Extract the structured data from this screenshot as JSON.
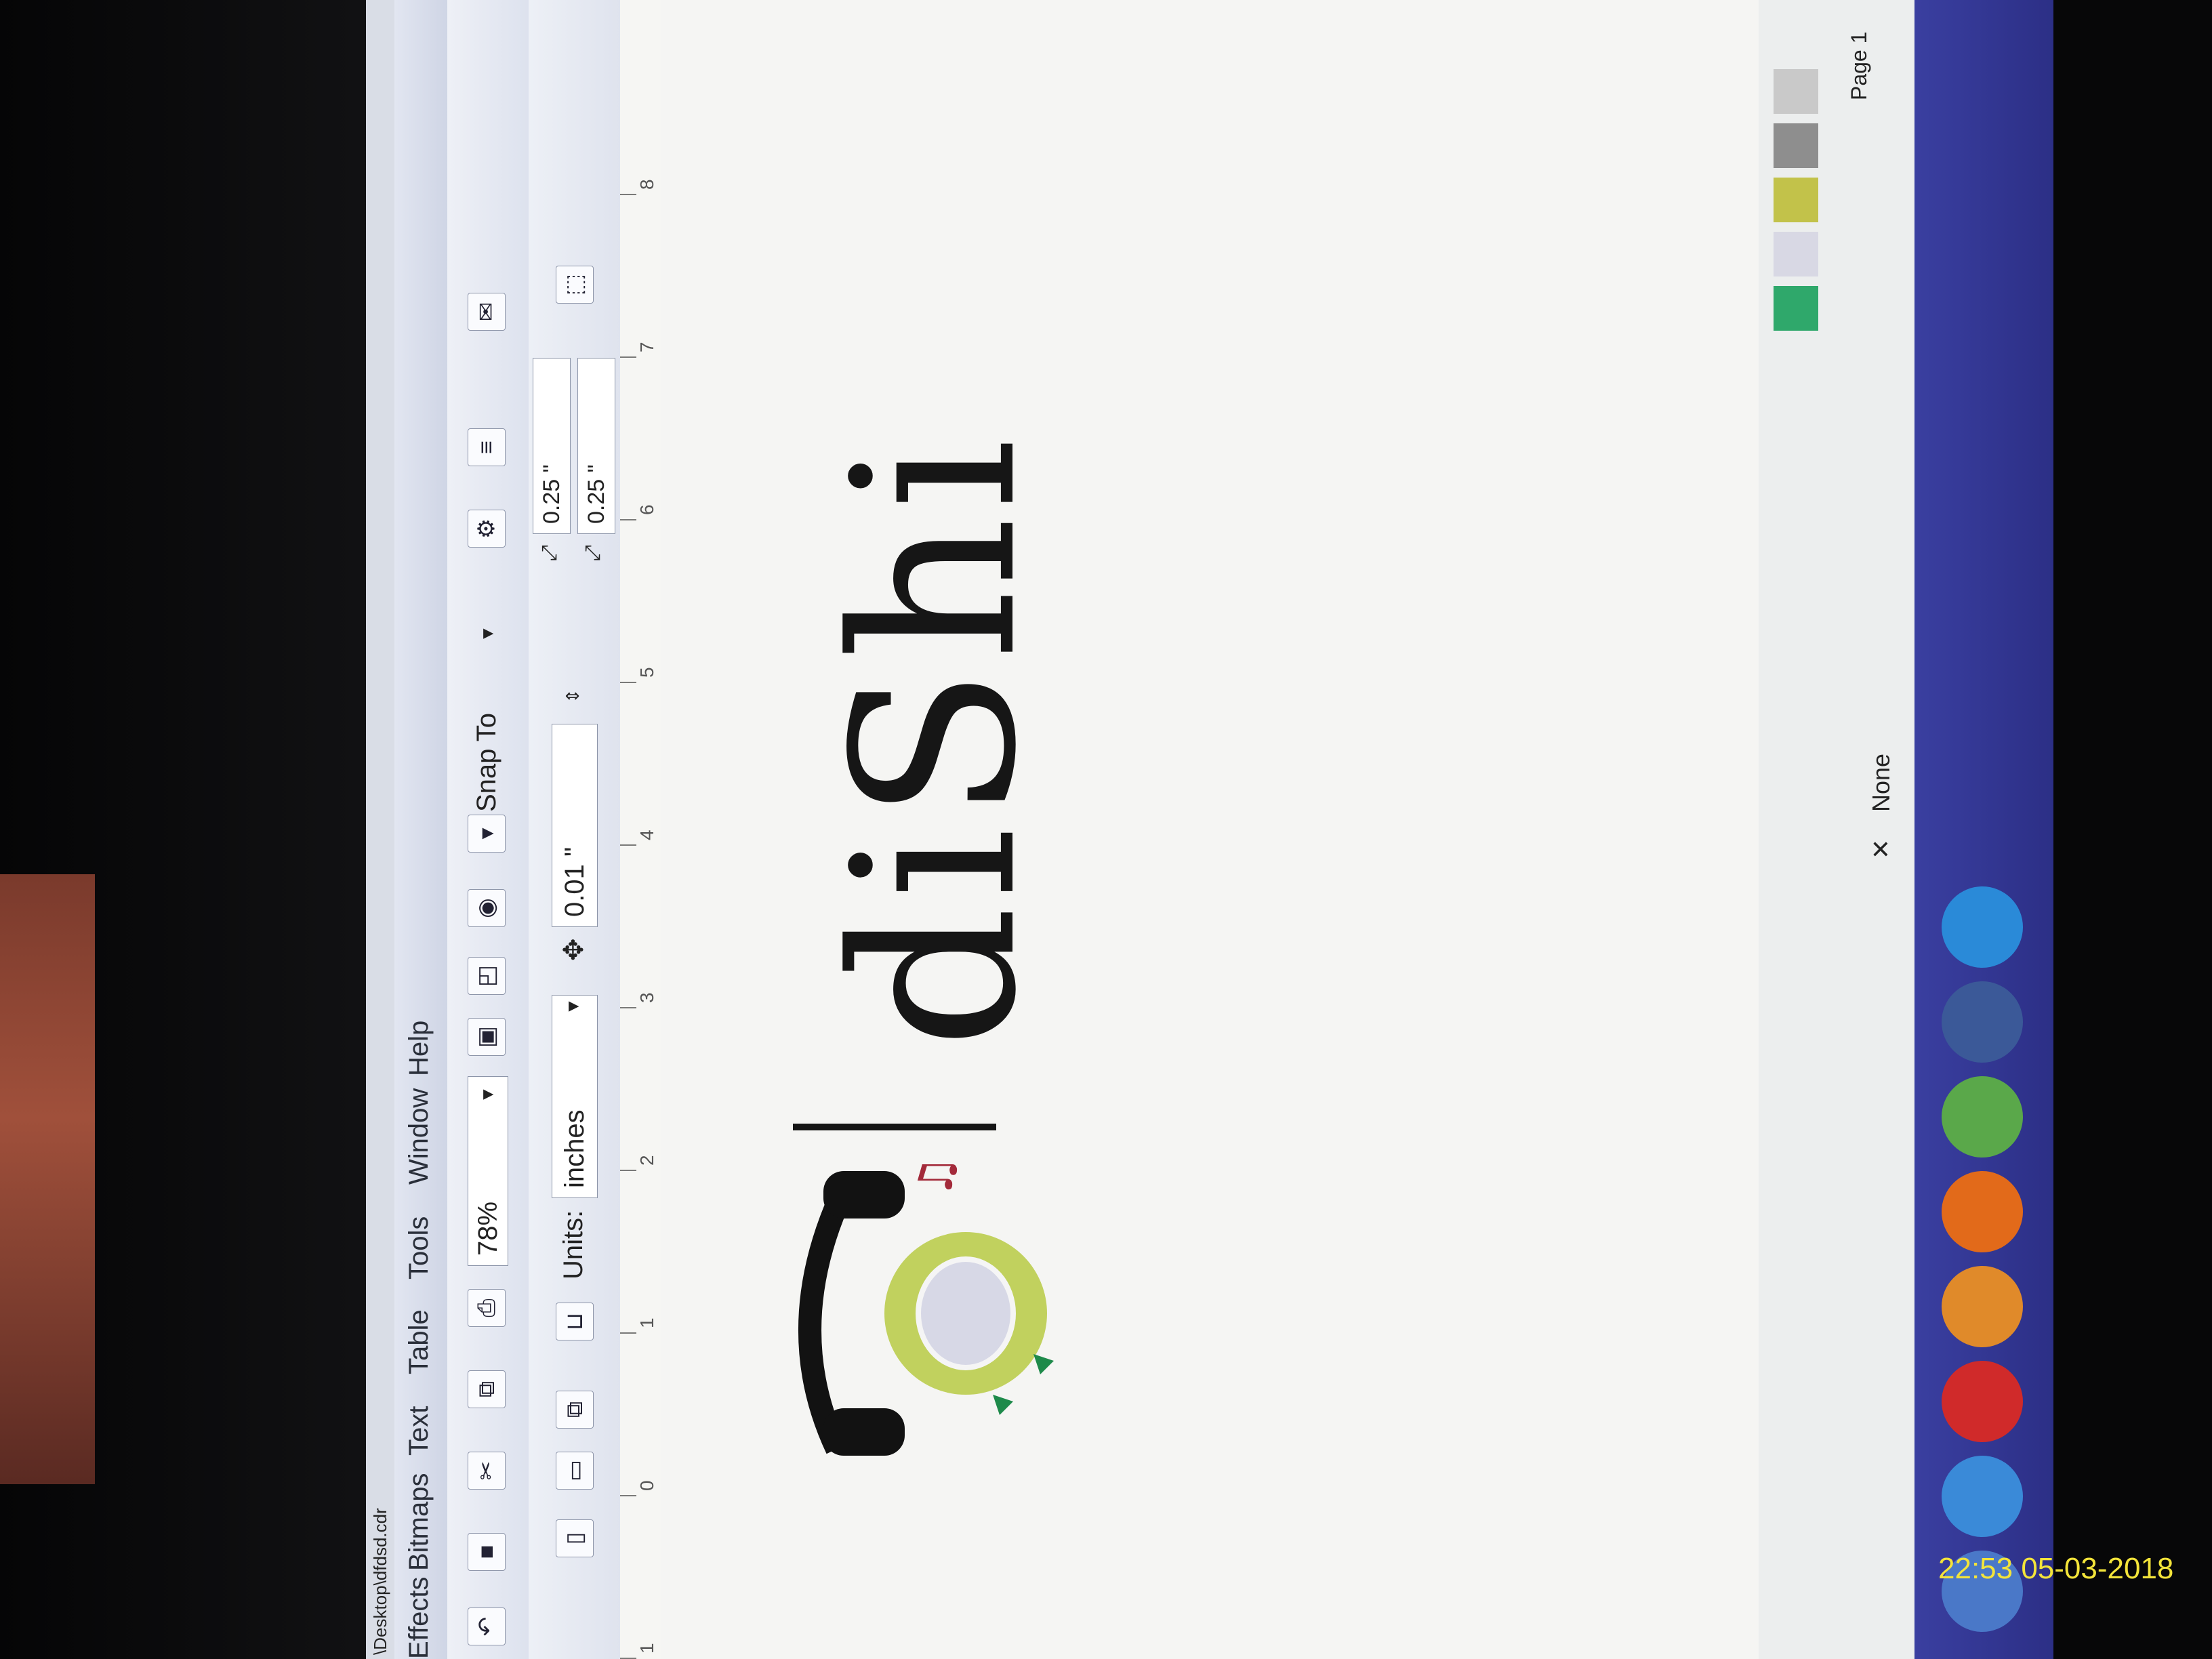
{
  "window": {
    "title": "\\Desktop\\dfdsd.cdr"
  },
  "menu": {
    "items": [
      "Effects",
      "Bitmaps",
      "Text",
      "Table",
      "Tools",
      "Window",
      "Help"
    ]
  },
  "toolbar": {
    "zoom_value": "78%",
    "snap_to_label": "Snap To",
    "units_label": "Units:",
    "units_value": "inches",
    "nudge_value": "0.01 \"",
    "duplicate_x": "0.25 \"",
    "duplicate_y": "0.25 \""
  },
  "ruler": {
    "ticks": [
      "1",
      "0",
      "1",
      "2",
      "3",
      "4",
      "5",
      "6",
      "7",
      "8"
    ]
  },
  "canvas": {
    "wordmark": "diShi"
  },
  "status": {
    "page_label": "Page 1",
    "fill_label": "None"
  },
  "palette": {
    "colors": [
      "#c9c9c9",
      "#8e8e8e",
      "#c2c24a",
      "#d8d8e4",
      "#2fa86b"
    ]
  },
  "taskbar": {
    "icons": [
      "windows-start",
      "tools",
      "opera",
      "corel",
      "firefox",
      "android",
      "facebook",
      "ie"
    ]
  },
  "overlay": {
    "timestamp": "22:53 05-03-2018"
  }
}
